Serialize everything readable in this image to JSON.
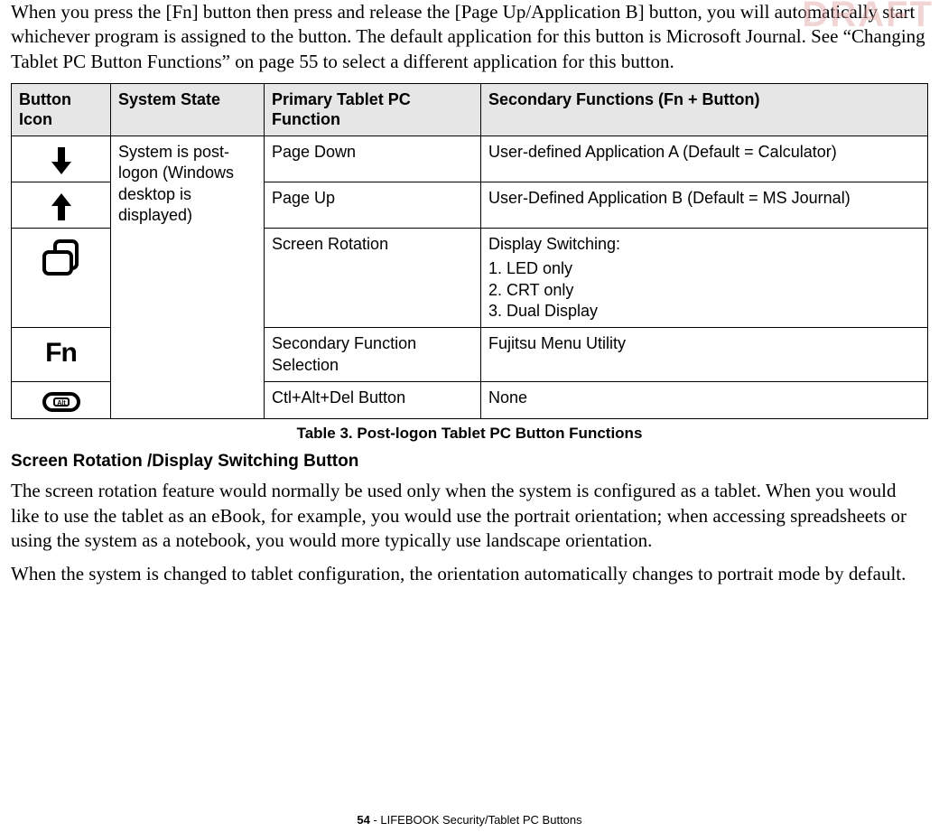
{
  "watermark": "DRAFT",
  "intro": "When you press the [Fn] button then press and release the [Page Up/Application B] button, you will automatically start whichever program is assigned to the button. The default application for this button is Microsoft Journal. See “Changing Tablet PC Button Functions” on page 55 to select a different application for this button.",
  "table": {
    "headers": {
      "icon": "Button Icon",
      "state": "System State",
      "primary": "Primary Tablet PC Function",
      "secondary": "Secondary Functions (Fn + Button)"
    },
    "system_state": "System is post-logon (Windows desktop is displayed)",
    "rows": [
      {
        "icon": "arrow-down-icon",
        "primary": "Page Down",
        "secondary": "User-defined Application A (Default = Calculator)"
      },
      {
        "icon": "arrow-up-icon",
        "primary": "Page Up",
        "secondary": "User-Defined Application B (Default = MS Journal)"
      },
      {
        "icon": "screen-rotation-icon",
        "primary": "Screen Rotation",
        "secondary_title": "Display Switching:",
        "secondary_items": [
          "1. LED only",
          "2. CRT only",
          "3. Dual Display"
        ]
      },
      {
        "icon": "fn-icon",
        "icon_text": "Fn",
        "primary": "Secondary Function Selection",
        "secondary": "Fujitsu Menu Utility"
      },
      {
        "icon": "ctrl-alt-del-icon",
        "primary": "Ctl+Alt+Del Button",
        "secondary": "None"
      }
    ]
  },
  "caption": "Table 3.  Post-logon Tablet PC Button Functions",
  "heading": "Screen Rotation /Display Switching Button",
  "para1": "The screen rotation feature would normally be used only when the system is configured as a tablet. When you would like to use the tablet as an eBook, for example, you would use the portrait orientation; when accessing spreadsheets or using the system as a notebook, you would more typically use landscape orientation.",
  "para2": "When the system is changed to tablet configuration, the orientation automatically changes to portrait mode by default.",
  "footer": {
    "page": "54",
    "sep": " - ",
    "title": "LIFEBOOK Security/Tablet PC Buttons"
  }
}
